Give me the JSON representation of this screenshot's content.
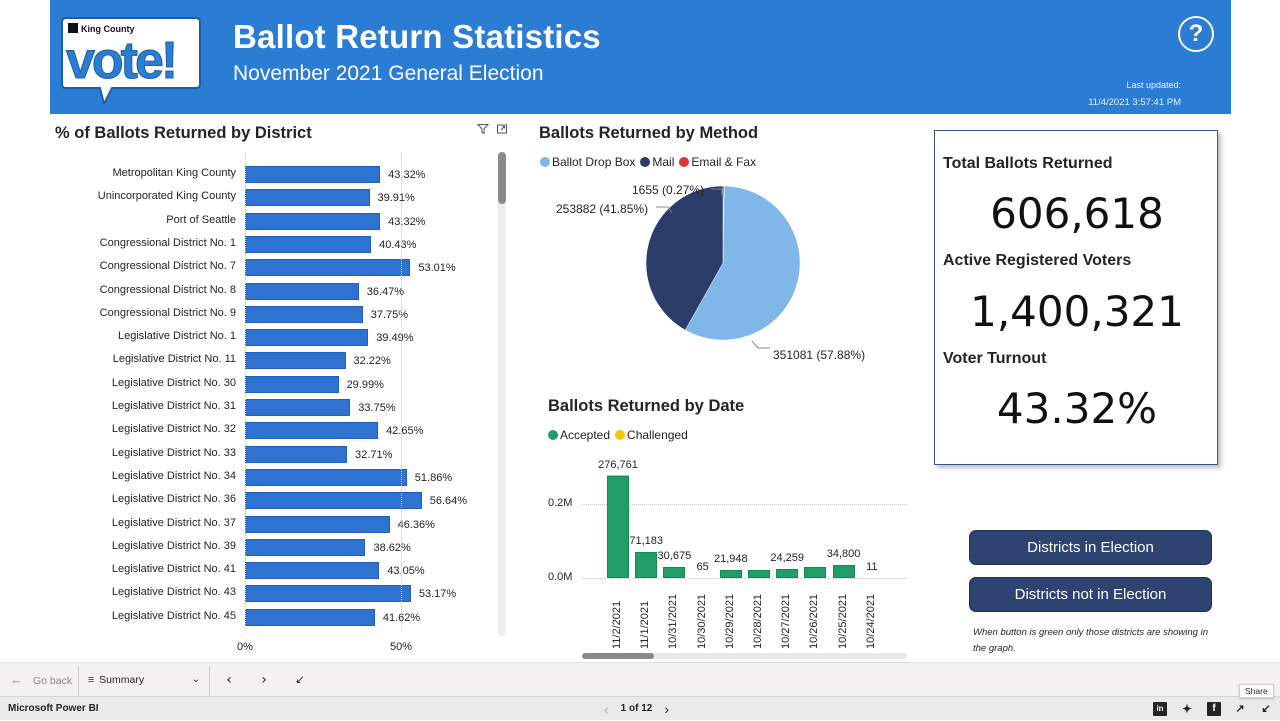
{
  "header": {
    "logo_text_small": "King County",
    "logo_text_big": "vote!",
    "title": "Ballot Return Statistics",
    "subtitle": "November 2021 General Election",
    "help_label": "?",
    "last_updated_label": "Last updated:",
    "last_updated_value": "11/4/2021 3:57:41 PM"
  },
  "district_chart": {
    "title": "% of Ballots Returned by District",
    "icons": [
      "filter-icon",
      "focus-mode-icon"
    ]
  },
  "method_chart": {
    "title": "Ballots Returned by Method"
  },
  "date_chart": {
    "title": "Ballots Returned by Date"
  },
  "chart_data": [
    {
      "type": "bar",
      "orientation": "horizontal",
      "title": "% of Ballots Returned by District",
      "xlabel": "",
      "ylabel": "",
      "xlim": [
        0,
        60
      ],
      "x_ticks": [
        "0%",
        "50%"
      ],
      "grid": true,
      "categories": [
        "Metropolitan King County",
        "Unincorporated King County",
        "Port of Seattle",
        "Congressional District No. 1",
        "Congressional District No. 7",
        "Congressional District No. 8",
        "Congressional District No. 9",
        "Legislative District No. 1",
        "Legislative District No. 11",
        "Legislative District No. 30",
        "Legislative District No. 31",
        "Legislative District No. 32",
        "Legislative District No. 33",
        "Legislative District No. 34",
        "Legislative District No. 36",
        "Legislative District No. 37",
        "Legislative District No. 39",
        "Legislative District No. 41",
        "Legislative District No. 43",
        "Legislative District No. 45"
      ],
      "values": [
        43.32,
        39.91,
        43.32,
        40.43,
        53.01,
        36.47,
        37.75,
        39.49,
        32.22,
        29.99,
        33.75,
        42.65,
        32.71,
        51.86,
        56.64,
        46.36,
        38.62,
        43.05,
        53.17,
        41.62
      ],
      "data_labels": [
        "43.32%",
        "39.91%",
        "43.32%",
        "40.43%",
        "53.01%",
        "36.47%",
        "37.75%",
        "39.49%",
        "32.22%",
        "29.99%",
        "33.75%",
        "42.65%",
        "32.71%",
        "51.86%",
        "56.64%",
        "46.36%",
        "38.62%",
        "43.05%",
        "53.17%",
        "41.62%"
      ],
      "color": "#2f73d2"
    },
    {
      "type": "pie",
      "title": "Ballots Returned by Method",
      "legend_position": "top-left",
      "slices": [
        {
          "name": "Ballot Drop Box",
          "value": 351081,
          "percent": 57.88,
          "label": "351081 (57.88%)",
          "color": "#7fb8e8"
        },
        {
          "name": "Mail",
          "value": 253882,
          "percent": 41.85,
          "label": "253882 (41.85%)",
          "color": "#2b3c6b"
        },
        {
          "name": "Email & Fax",
          "value": 1655,
          "percent": 0.27,
          "label": "1655 (0.27%)",
          "color": "#e0343a"
        }
      ]
    },
    {
      "type": "bar",
      "stacked": true,
      "title": "Ballots Returned by Date",
      "legend_position": "top-left",
      "ylim": [
        0,
        300000
      ],
      "y_ticks": [
        {
          "value": 0,
          "label": "0.0M"
        },
        {
          "value": 200000,
          "label": "0.2M"
        }
      ],
      "grid": true,
      "categories": [
        "11/2/2021",
        "11/1/2021",
        "10/31/2021",
        "10/30/2021",
        "10/29/2021",
        "10/28/2021",
        "10/27/2021",
        "10/26/2021",
        "10/25/2021",
        "10/24/2021"
      ],
      "series": [
        {
          "name": "Accepted",
          "color": "#1f9e67",
          "values": [
            274500,
            70800,
            30500,
            65,
            21800,
            22500,
            24100,
            29000,
            34600,
            11
          ]
        },
        {
          "name": "Challenged",
          "color": "#f2c80f",
          "values": [
            2261,
            383,
            175,
            0,
            148,
            0,
            159,
            0,
            200,
            0
          ]
        }
      ],
      "total_labels": [
        "276,761",
        "71,183",
        "30,675",
        "65",
        "21,948",
        "",
        "24,259",
        "",
        "34,800",
        "11"
      ]
    }
  ],
  "kpis": [
    {
      "label": "Total Ballots Returned",
      "value": "606,618"
    },
    {
      "label": "Active Registered Voters",
      "value": "1,400,321"
    },
    {
      "label": "Voter Turnout",
      "value": "43.32%"
    }
  ],
  "buttons": {
    "districts_in": "Districts in Election",
    "districts_not_in": "Districts not in Election",
    "note": "When button is green only those districts are showing in the graph."
  },
  "navbar": {
    "back_label": "Go back",
    "page_label": "Summary"
  },
  "statusbar": {
    "brand": "Microsoft Power BI",
    "pager": "1 of 12",
    "share_tooltip": "Share",
    "social": [
      "linkedin-icon",
      "twitter-icon",
      "facebook-icon",
      "share-icon",
      "fullscreen-icon"
    ]
  }
}
